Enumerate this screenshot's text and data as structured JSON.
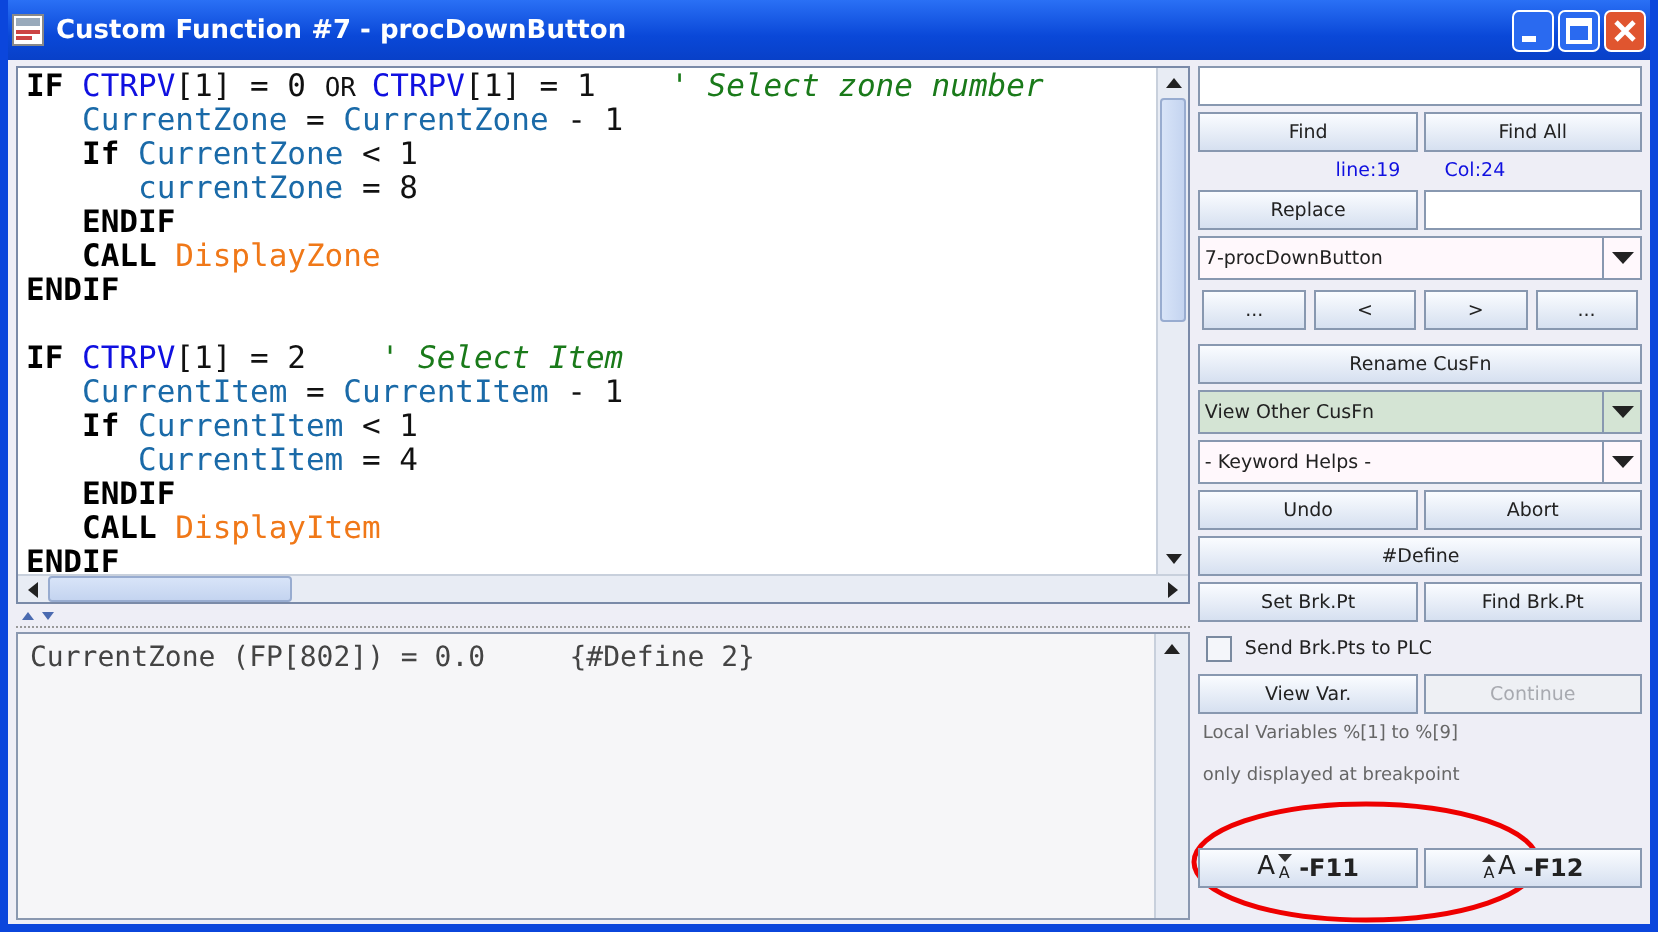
{
  "window": {
    "title": "Custom Function #7 - procDownButton"
  },
  "editor": {
    "lines": [
      {
        "tokens": [
          {
            "text": "IF ",
            "kind": "keyword"
          },
          {
            "text": "CTRPV",
            "kind": "array"
          },
          {
            "text": "[1] = 0 ",
            "kind": "plain"
          },
          {
            "text": "OR ",
            "kind": "small"
          },
          {
            "text": "CTRPV",
            "kind": "array"
          },
          {
            "text": "[1] = 1    ",
            "kind": "plain"
          },
          {
            "text": "' Select zone number",
            "kind": "comment"
          }
        ]
      },
      {
        "tokens": [
          {
            "text": "   CurrentZone",
            "kind": "variable"
          },
          {
            "text": " = ",
            "kind": "plain"
          },
          {
            "text": "CurrentZone",
            "kind": "variable"
          },
          {
            "text": " - 1",
            "kind": "plain"
          }
        ]
      },
      {
        "tokens": [
          {
            "text": "   If ",
            "kind": "keyword"
          },
          {
            "text": "CurrentZone",
            "kind": "variable"
          },
          {
            "text": " < 1",
            "kind": "plain"
          }
        ]
      },
      {
        "tokens": [
          {
            "text": "      currentZone",
            "kind": "variable"
          },
          {
            "text": " = 8",
            "kind": "plain"
          }
        ]
      },
      {
        "tokens": [
          {
            "text": "   ENDIF",
            "kind": "keyword"
          }
        ]
      },
      {
        "tokens": [
          {
            "text": "   CALL ",
            "kind": "keyword"
          },
          {
            "text": "DisplayZone",
            "kind": "function"
          }
        ]
      },
      {
        "tokens": [
          {
            "text": "ENDIF",
            "kind": "keyword"
          }
        ]
      },
      {
        "spaced": true,
        "tokens": [
          {
            "text": "IF ",
            "kind": "keyword"
          },
          {
            "text": "CTRPV",
            "kind": "array"
          },
          {
            "text": "[1] = 2    ",
            "kind": "plain"
          },
          {
            "text": "' Select Item",
            "kind": "comment"
          }
        ]
      },
      {
        "tokens": [
          {
            "text": "   CurrentItem",
            "kind": "variable"
          },
          {
            "text": " = ",
            "kind": "plain"
          },
          {
            "text": "CurrentItem",
            "kind": "variable"
          },
          {
            "text": " - 1",
            "kind": "plain"
          }
        ]
      },
      {
        "tokens": [
          {
            "text": "   If ",
            "kind": "keyword"
          },
          {
            "text": "CurrentItem",
            "kind": "variable"
          },
          {
            "text": " < 1",
            "kind": "plain"
          }
        ]
      },
      {
        "tokens": [
          {
            "text": "      CurrentItem",
            "kind": "variable"
          },
          {
            "text": " = 4",
            "kind": "plain"
          }
        ]
      },
      {
        "tokens": [
          {
            "text": "   ENDIF",
            "kind": "keyword"
          }
        ]
      },
      {
        "tokens": [
          {
            "text": "   CALL ",
            "kind": "keyword"
          },
          {
            "text": "DisplayItem",
            "kind": "function"
          }
        ]
      },
      {
        "tokens": [
          {
            "text": "ENDIF",
            "kind": "keyword"
          }
        ]
      }
    ]
  },
  "output": {
    "text": "CurrentZone (FP[802]) = 0.0     {#Define 2}"
  },
  "panel": {
    "rows": [
      {
        "kind": "field"
      },
      {
        "kind": "buttons",
        "buttons": [
          {
            "label": "Find",
            "disabled": false
          },
          {
            "label": "Find All",
            "disabled": false
          }
        ]
      },
      {
        "kind": "position",
        "line": "line:19",
        "col": "Col:24"
      },
      {
        "kind": "button-field",
        "label": "Replace"
      },
      {
        "kind": "combo",
        "value": "7-procDownButton",
        "highlighted": false
      },
      {
        "kind": "nav",
        "buttons": [
          {
            "label": "...",
            "disabled": false
          },
          {
            "label": "<",
            "disabled": false
          },
          {
            "label": ">",
            "disabled": false
          },
          {
            "label": "...",
            "disabled": false
          }
        ]
      },
      {
        "kind": "buttons",
        "buttons": [
          {
            "label": "Rename CusFn",
            "disabled": false
          }
        ]
      },
      {
        "kind": "combo",
        "value": "View Other CusFn",
        "highlighted": true
      },
      {
        "kind": "combo",
        "value": "- Keyword Helps -",
        "highlighted": false
      },
      {
        "kind": "buttons",
        "buttons": [
          {
            "label": "Undo",
            "disabled": false
          },
          {
            "label": "Abort",
            "disabled": false
          }
        ]
      },
      {
        "kind": "buttons",
        "buttons": [
          {
            "label": "#Define",
            "disabled": false
          }
        ]
      },
      {
        "kind": "buttons",
        "buttons": [
          {
            "label": "Set Brk.Pt",
            "disabled": false
          },
          {
            "label": "Find Brk.Pt",
            "disabled": false
          }
        ]
      },
      {
        "kind": "checkbox",
        "label": "Send Brk.Pts to PLC",
        "checked": false
      },
      {
        "kind": "buttons",
        "buttons": [
          {
            "label": "View Var.",
            "disabled": false
          },
          {
            "label": "Continue",
            "disabled": true
          }
        ]
      },
      {
        "kind": "note",
        "text": "Local Variables %[1] to %[9]"
      },
      {
        "kind": "note",
        "text": "only displayed at breakpoint"
      },
      {
        "kind": "font",
        "buttons": [
          {
            "big": "A",
            "small": "A",
            "label": "-F11",
            "kind": "decrease"
          },
          {
            "big": "A",
            "small": "A",
            "label": "-F12",
            "kind": "increase"
          }
        ]
      }
    ]
  }
}
